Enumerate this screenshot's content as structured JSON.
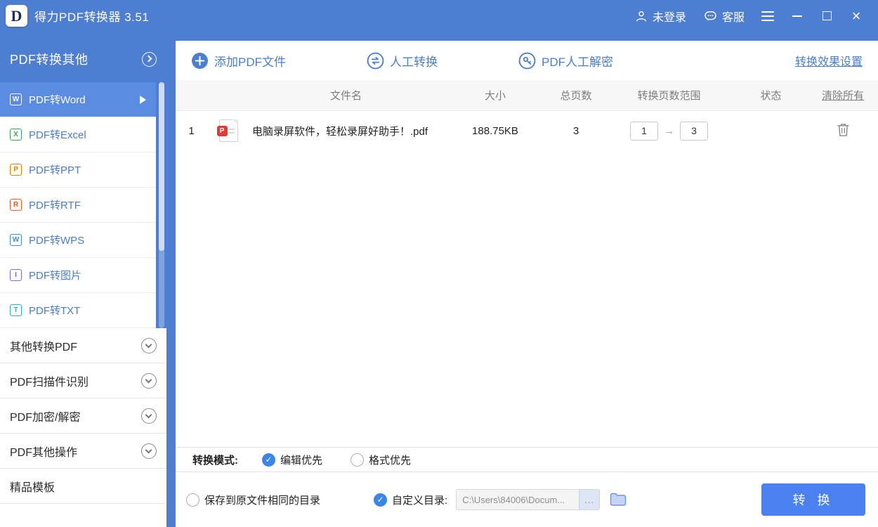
{
  "titlebar": {
    "logo": "D",
    "app_title": "得力PDF转换器 3.51",
    "login": "未登录",
    "service": "客服"
  },
  "sidebar": {
    "header": "PDF转换其他",
    "items": [
      {
        "label": "PDF转Word",
        "icon": "W"
      },
      {
        "label": "PDF转Excel",
        "icon": "X"
      },
      {
        "label": "PDF转PPT",
        "icon": "P"
      },
      {
        "label": "PDF转RTF",
        "icon": "R"
      },
      {
        "label": "PDF转WPS",
        "icon": "W"
      },
      {
        "label": "PDF转图片",
        "icon": "I"
      },
      {
        "label": "PDF转TXT",
        "icon": "T"
      }
    ],
    "sections": [
      {
        "label": "其他转换PDF"
      },
      {
        "label": "PDF扫描件识别"
      },
      {
        "label": "PDF加密/解密"
      },
      {
        "label": "PDF其他操作"
      },
      {
        "label": "精品模板"
      }
    ]
  },
  "toolbar": {
    "add_pdf": "添加PDF文件",
    "manual_convert": "人工转换",
    "manual_decrypt": "PDF人工解密",
    "settings_link": "转换效果设置"
  },
  "table": {
    "col_filename": "文件名",
    "col_size": "大小",
    "col_pages": "总页数",
    "col_range": "转换页数范围",
    "col_status": "状态",
    "clear_all": "清除所有",
    "rows": [
      {
        "index": "1",
        "badge": "P",
        "filename": "电脑录屏软件，轻松录屏好助手！.pdf",
        "size": "188.75KB",
        "pages": "3",
        "range_from": "1",
        "range_arrow": "→",
        "range_to": "3"
      }
    ]
  },
  "mode_bar": {
    "label": "转换模式:",
    "check_glyph": "✓",
    "option_edit": "编辑优先",
    "option_format": "格式优先"
  },
  "bottom_bar": {
    "save_original": "保存到原文件相同的目录",
    "custom_dir": "自定义目录:",
    "dir_value": "C:\\Users\\84006\\Docum...",
    "browse": "...",
    "convert": "转 换"
  },
  "colors": {
    "primary_blue": "#4d7ed2",
    "accent_blue": "#4a80ef",
    "pdf_red": "#e53935"
  }
}
